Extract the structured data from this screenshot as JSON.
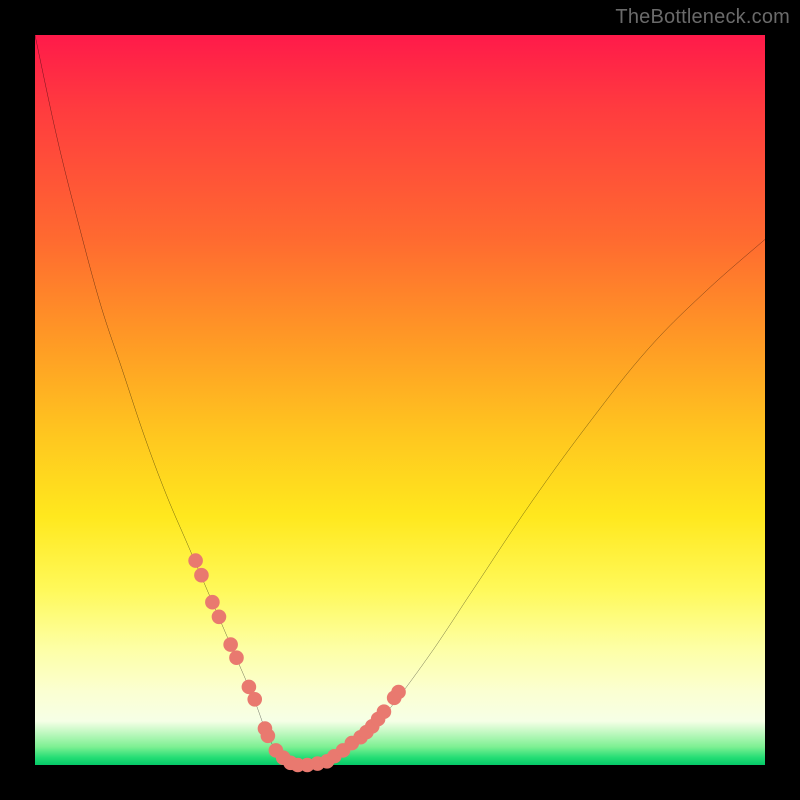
{
  "watermark": "TheBottleneck.com",
  "colors": {
    "frame": "#000000",
    "curve": "#000000",
    "marker": "#e9796f",
    "gradient_top": "#ff1a4a",
    "gradient_bottom": "#05c968"
  },
  "chart_data": {
    "type": "line",
    "title": "",
    "xlabel": "",
    "ylabel": "",
    "xlim": [
      0,
      100
    ],
    "ylim": [
      0,
      100
    ],
    "grid": false,
    "legend": false,
    "series": [
      {
        "name": "bottleneck-curve",
        "x": [
          0,
          3,
          6,
          9,
          12,
          15,
          18,
          21,
          24,
          27,
          30,
          31.5,
          33,
          34.5,
          36,
          38,
          40,
          44,
          48,
          54,
          60,
          68,
          76,
          84,
          92,
          100
        ],
        "y": [
          100,
          86,
          74,
          63,
          54,
          45,
          37,
          30,
          23,
          16,
          9,
          5,
          2,
          0.7,
          0,
          0,
          0.5,
          3,
          7,
          15,
          24,
          36,
          47,
          57,
          65,
          72
        ]
      }
    ],
    "markers": {
      "name": "highlight-beads",
      "x": [
        22.0,
        22.8,
        24.3,
        25.2,
        26.8,
        27.6,
        29.3,
        30.1,
        31.5,
        31.9,
        33.0,
        34.0,
        35.0,
        36.0,
        37.3,
        38.7,
        40.0,
        41.0,
        42.2,
        43.4,
        44.6,
        45.4,
        46.2,
        47.0,
        47.8,
        49.2,
        49.8
      ],
      "y": [
        28.0,
        26.0,
        22.3,
        20.3,
        16.5,
        14.7,
        10.7,
        9.0,
        5.0,
        4.0,
        2.0,
        1.0,
        0.3,
        0.0,
        0.0,
        0.2,
        0.5,
        1.2,
        2.0,
        3.0,
        3.8,
        4.5,
        5.3,
        6.3,
        7.3,
        9.2,
        10.0
      ],
      "r": 1.0
    }
  }
}
